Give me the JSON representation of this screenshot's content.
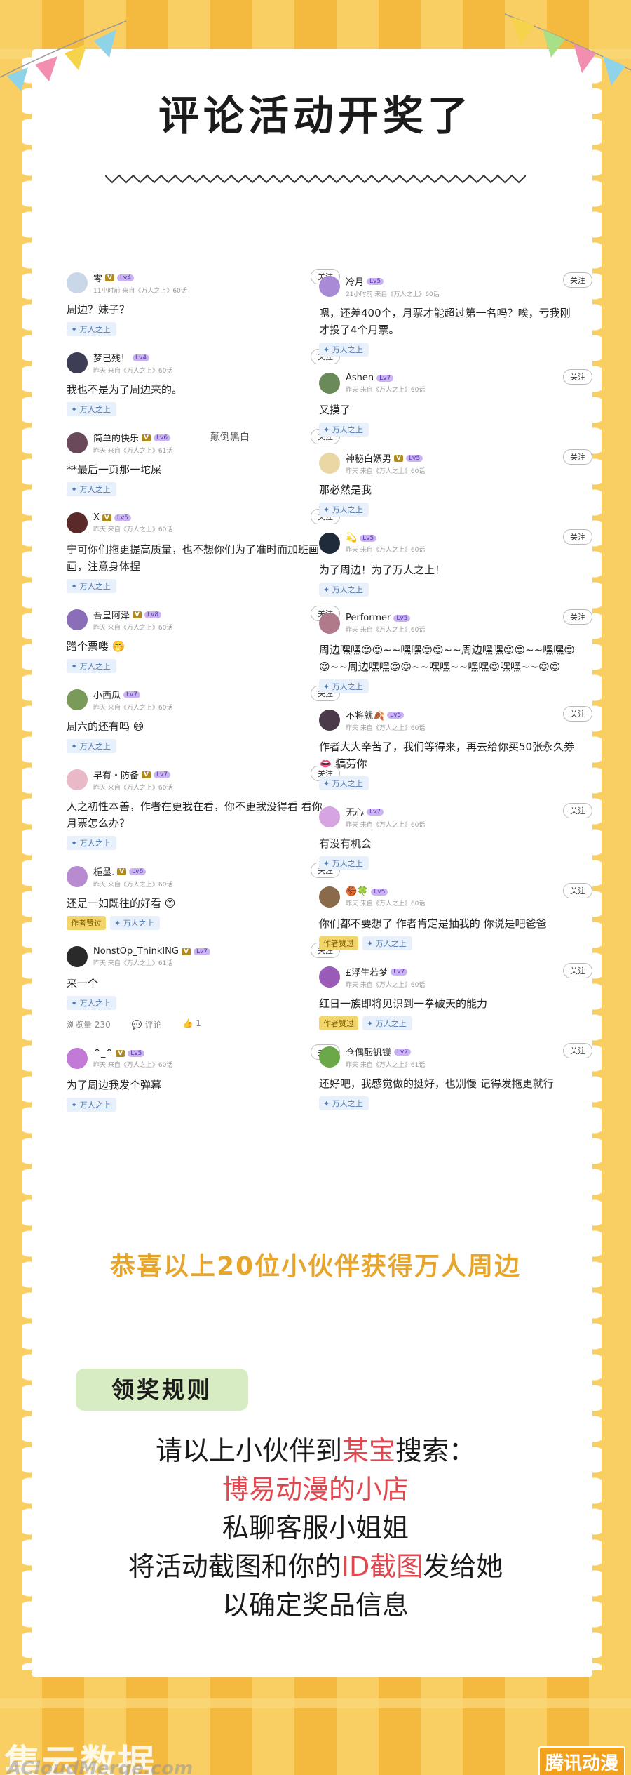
{
  "title": "评论活动开奖了",
  "left_comments": [
    {
      "name": "零",
      "level": "Lv4",
      "vip": true,
      "meta": "11小时前 来自《万人之上》60话",
      "text": "周边？妹子？",
      "tag": "万人之上",
      "author_like": false,
      "follow": "关注",
      "avatar_color": "#c9d7e8"
    },
    {
      "name": "梦已残！",
      "level": "Lv4",
      "vip": false,
      "meta": "昨天 来自《万人之上》60话",
      "text": "我也不是为了周边来的。",
      "tag": "万人之上",
      "author_like": false,
      "follow": "关注",
      "avatar_color": "#3d3d55"
    },
    {
      "name": "简单的快乐",
      "level": "Lv6",
      "vip": true,
      "meta": "昨天 来自《万人之上》61话",
      "text": "**最后一页那一坨屎",
      "tag": "万人之上",
      "author_like": false,
      "follow": "关注",
      "avatar_color": "#6a4a5a"
    },
    {
      "name": "X",
      "level": "Lv5",
      "vip": true,
      "meta": "昨天 来自《万人之上》60话",
      "text": "宁可你们拖更提高质量，也不想你们为了准时而加班画画，注意身体捏",
      "tag": "万人之上",
      "author_like": false,
      "follow": "关注",
      "avatar_color": "#5a2a2a"
    },
    {
      "name": "吾皇阿泽",
      "level": "Lv8",
      "vip": true,
      "meta": "昨天 来自《万人之上》60话",
      "text": "蹭个票喽 🤭",
      "tag": "万人之上",
      "author_like": false,
      "follow": "关注",
      "avatar_color": "#8a6fb8"
    },
    {
      "name": "小西瓜",
      "level": "Lv7",
      "vip": false,
      "meta": "昨天 来自《万人之上》60话",
      "text": "周六的还有吗 😄",
      "tag": "万人之上",
      "author_like": false,
      "follow": "关注",
      "avatar_color": "#7a9a5a"
    },
    {
      "name": "早有・防备",
      "level": "Lv7",
      "vip": true,
      "meta": "昨天 来自《万人之上》60话",
      "text": "人之初性本善，作者在更我在看，你不更我没得看 看你月票怎么办？",
      "tag": "万人之上",
      "author_like": false,
      "follow": "关注",
      "avatar_color": "#e9b9c8"
    },
    {
      "name": "梔墨.",
      "level": "Lv6",
      "vip": true,
      "meta": "昨天 来自《万人之上》60话",
      "text": "还是一如既往的好看 😊",
      "tag": "万人之上",
      "author_like": true,
      "author_label": "作者赞过",
      "follow": "关注",
      "avatar_color": "#b88ad0"
    },
    {
      "name": "NonstOp_ThinkING",
      "level": "Lv7",
      "vip": true,
      "meta": "昨天 来自《万人之上》61话",
      "text": "来一个",
      "tag": "万人之上",
      "author_like": false,
      "follow": "关注",
      "avatar_color": "#2a2a2a"
    },
    {
      "name": "^_^",
      "level": "Lv5",
      "vip": true,
      "meta": "昨天 来自《万人之上》60话",
      "text": "为了周边我发个弹幕",
      "tag": "万人之上",
      "author_like": false,
      "follow": "关注",
      "avatar_color": "#c27ad6"
    }
  ],
  "stats": {
    "views": "浏览量 230",
    "comment": "评论",
    "likes": "1"
  },
  "right_comments": [
    {
      "name": "冷月",
      "level": "Lv5",
      "vip": false,
      "meta": "21小时前 来自《万人之上》60话",
      "text": "嗯，还差400个，月票才能超过第一名吗？唉，亏我刚才投了4个月票。",
      "tag": "万人之上",
      "author_like": false,
      "follow": "关注",
      "avatar_color": "#a98ad6"
    },
    {
      "name": "Ashen",
      "level": "Lv7",
      "vip": false,
      "meta": "昨天 来自《万人之上》60话",
      "text": "又摸了",
      "tag": "万人之上",
      "author_like": false,
      "follow": "关注",
      "avatar_color": "#6b8a5a"
    },
    {
      "name": "神秘白嫖男",
      "level": "Lv5",
      "vip": true,
      "meta": "昨天 来自《万人之上》60话",
      "text": "那必然是我",
      "tag": "万人之上",
      "author_like": false,
      "follow": "关注",
      "avatar_color": "#e9d7a4"
    },
    {
      "name": "💫",
      "level": "Lv5",
      "vip": false,
      "meta": "昨天 来自《万人之上》60话",
      "text": "为了周边！为了万人之上！",
      "tag": "万人之上",
      "author_like": false,
      "follow": "关注",
      "avatar_color": "#1f2a3a"
    },
    {
      "name": "Performer",
      "level": "Lv5",
      "vip": false,
      "meta": "昨天 来自《万人之上》60话",
      "text": "周边嘿嘿😍😍~~嘿嘿😍😍~~周边嘿嘿😍😍~~嘿嘿😍😍~~周边嘿嘿😍😍~~嘿嘿~~嘿嘿😍嘿嘿~~😍😍",
      "tag": "万人之上",
      "author_like": false,
      "follow": "关注",
      "avatar_color": "#b07a8a"
    },
    {
      "name": "不将就🍂",
      "level": "Lv5",
      "vip": false,
      "meta": "昨天 来自《万人之上》60话",
      "text": "作者大大辛苦了，我们等得来，再去给你买50张永久券 👄 犒劳你",
      "tag": "万人之上",
      "author_like": false,
      "follow": "关注",
      "avatar_color": "#4a3a4a"
    },
    {
      "name": "无心",
      "level": "Lv7",
      "vip": false,
      "meta": "昨天 来自《万人之上》60话",
      "text": "有没有机会",
      "tag": "万人之上",
      "author_like": false,
      "follow": "关注",
      "avatar_color": "#d6a4e0"
    },
    {
      "name": "🏀🍀",
      "level": "Lv5",
      "vip": false,
      "meta": "昨天 来自《万人之上》60话",
      "text": "你们都不要想了 作者肯定是抽我的 你说是吧爸爸",
      "tag": "万人之上",
      "author_like": true,
      "author_label": "作者赞过",
      "follow": "关注",
      "avatar_color": "#8a6a4a"
    },
    {
      "name": "£浮生若梦",
      "level": "Lv7",
      "vip": false,
      "meta": "昨天 来自《万人之上》60话",
      "text": "红日一族即将见识到一拳破天的能力",
      "tag": "万人之上",
      "author_like": true,
      "author_label": "作者赞过",
      "follow": "关注",
      "avatar_color": "#9a5ab8"
    },
    {
      "name": "仓偶酝钒镁",
      "level": "Lv7",
      "vip": false,
      "meta": "昨天 来自《万人之上》61话",
      "text": "还好吧，我感觉做的挺好，也别慢 记得发拖更就行",
      "tag": "万人之上",
      "author_like": false,
      "follow": "关注",
      "avatar_color": "#6aa84a"
    }
  ],
  "congrats": "恭喜以上20位小伙伴获得万人周边",
  "rule_label": "领奖规则",
  "instructions": {
    "line1_a": "请以上小伙伴到",
    "line1_b": "某宝",
    "line1_c": "搜索：",
    "line2": "博易动漫的小店",
    "line3": "私聊客服小姐姐",
    "line4_a": "将活动截图和你的",
    "line4_b": "ID截图",
    "line4_c": "发给她",
    "line5": "以确定奖品信息"
  },
  "overlay_text": "颠倒黑白",
  "watermark_left": "集云数据",
  "watermark_left_sub": "ACloudMerge.com",
  "watermark_right": "腾讯动漫",
  "colors": {
    "background": "#f7c24f",
    "accent_red": "#e2474f",
    "congrats": "#e7a52b",
    "rule_pill": "#d7ecc3"
  }
}
